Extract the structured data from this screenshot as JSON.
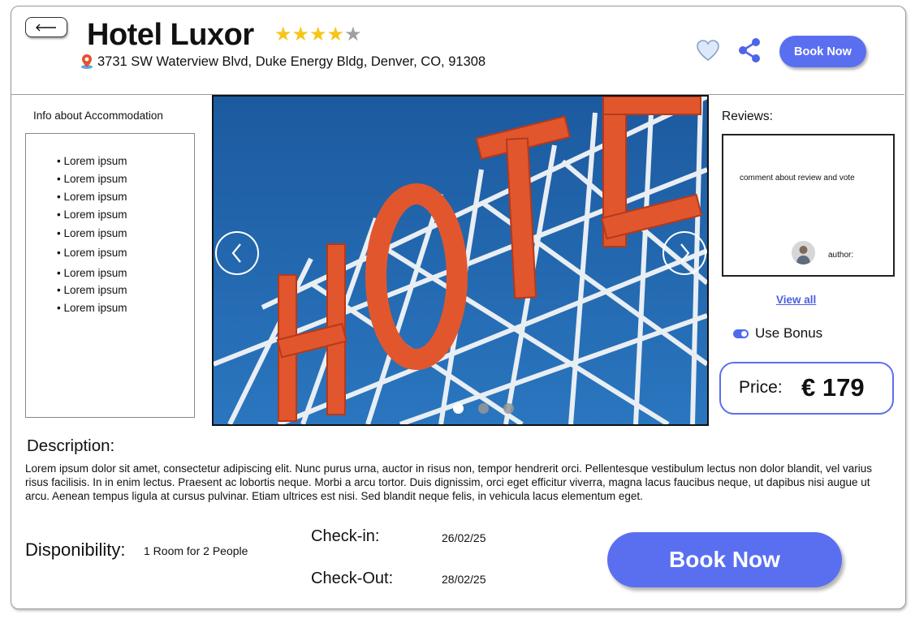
{
  "header": {
    "hotel_name": "Hotel Luxor",
    "rating": 4,
    "rating_max": 5,
    "address": "3731 SW Waterview Blvd, Duke Energy Bldg, Denver, CO, 91308",
    "book_now_label": "Book Now",
    "back_icon": "arrow-left-icon",
    "favorite_icon": "heart-icon",
    "share_icon": "share-icon",
    "location_icon": "map-pin-icon"
  },
  "info": {
    "title": "Info about Accommodation",
    "items": [
      "• Lorem ipsum",
      "• Lorem ipsum",
      "• Lorem ipsum",
      "• Lorem ipsum",
      "• Lorem ipsum",
      "• Lorem ipsum",
      "• Lorem ipsum",
      "• Lorem ipsum",
      "• Lorem ipsum"
    ]
  },
  "gallery": {
    "image_subject": "HOTEL",
    "slide_count": 3,
    "active_slide": 1
  },
  "reviews": {
    "title": "Reviews:",
    "comment": "comment about review and vote",
    "author_label": "author:",
    "view_all_label": "View all"
  },
  "bonus": {
    "label": "Use Bonus",
    "enabled": true
  },
  "price": {
    "label": "Price:",
    "value": "€ 179"
  },
  "description": {
    "title": "Description:",
    "text": "Lorem ipsum dolor sit amet, consectetur adipiscing elit. Nunc purus urna, auctor in risus non, tempor hendrerit orci. Pellentesque vestibulum lectus non dolor blandit, vel varius risus facilisis. In in enim lectus. Praesent ac lobortis neque. Morbi a arcu tortor. Duis dignissim, orci eget efficitur viverra, magna lacus faucibus neque, ut dapibus nisi augue ut arcu. Aenean tempus ligula at cursus pulvinar. Etiam ultrices est nisi. Sed blandit neque felis, in vehicula lacus elementum eget."
  },
  "booking": {
    "disponibility_label": "Disponibility:",
    "disponibility_value": "1 Room  for  2 People",
    "checkin_label": "Check-in:",
    "checkin_date": "26/02/25",
    "checkout_label": "Check-Out:",
    "checkout_date": "28/02/25",
    "book_now_label": "Book Now"
  },
  "colors": {
    "accent": "#5a6ff0",
    "star": "#f5c518",
    "star_empty": "#a0a0a0",
    "sign": "#e2562d",
    "sky": "#1f63a8"
  }
}
